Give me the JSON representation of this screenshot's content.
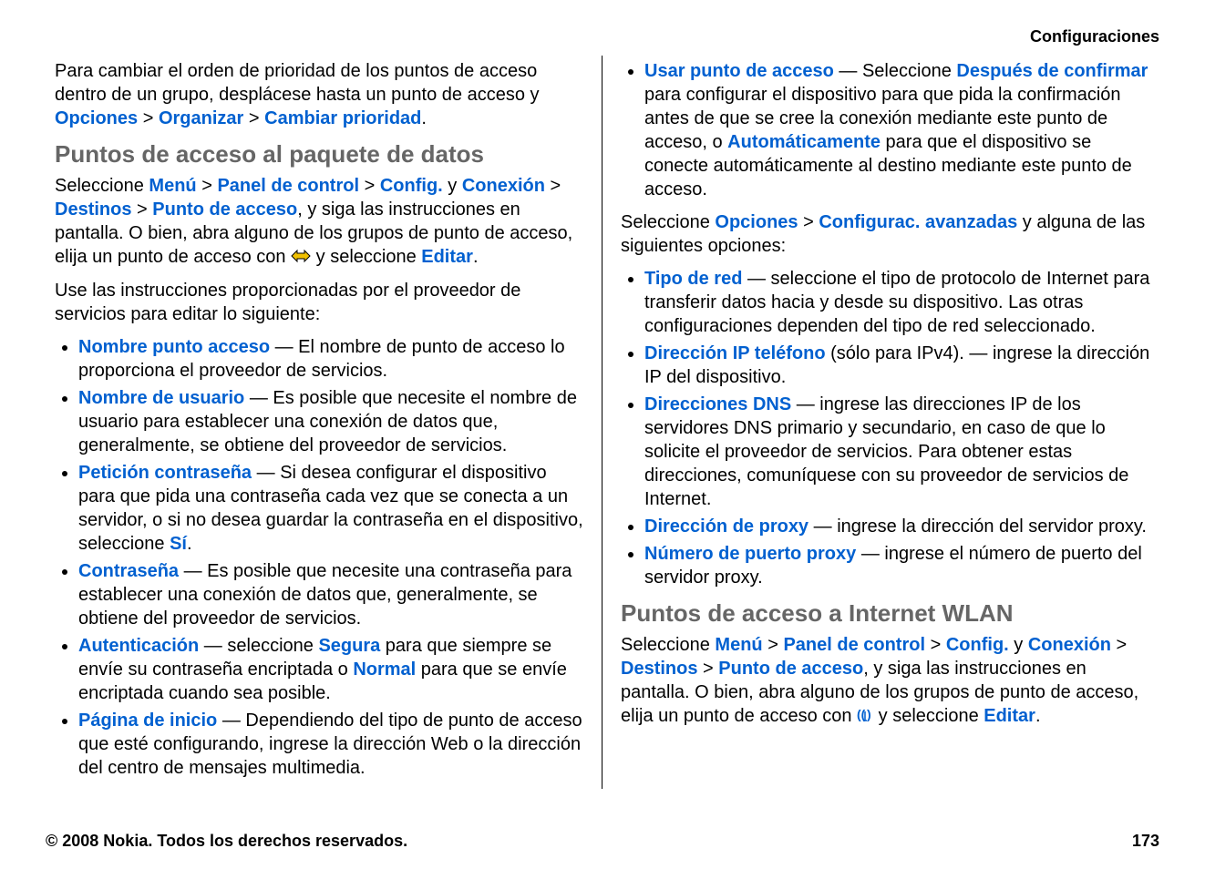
{
  "header": "Configuraciones",
  "left": {
    "intro_p1_a": "Para cambiar el orden de prioridad de los puntos de acceso dentro de un grupo, desplácese hasta un punto de acceso y ",
    "intro_opciones": "Opciones",
    "gt": ">",
    "intro_organizar": "Organizar",
    "intro_cambiar": "Cambiar prioridad",
    "period": ".",
    "h_datos": "Puntos de acceso al paquete de datos",
    "sel_a": "Seleccione ",
    "menu": "Menú",
    "panel": "Panel de control",
    "config": "Config.",
    "y": " y ",
    "conexion": "Conexión",
    "destinos": "Destinos",
    "punto_acceso": "Punto de acceso",
    "sel_b": ", y siga las instrucciones en pantalla. O bien, abra alguno de los grupos de punto de acceso, elija un punto de acceso con ",
    "sel_c": " y seleccione ",
    "editar": "Editar",
    "use_p": "Use las instrucciones proporcionadas por el proveedor de servicios para editar lo siguiente:",
    "items": [
      {
        "term": "Nombre punto acceso",
        "dash": " — ",
        "text": "El nombre de punto de acceso lo proporciona el proveedor de servicios."
      },
      {
        "term": "Nombre de usuario",
        "dash": " — ",
        "text": "Es posible que necesite el nombre de usuario para establecer una conexión de datos que, generalmente, se obtiene del proveedor de servicios."
      },
      {
        "term": "Petición contraseña",
        "dash": " — ",
        "text_a": "Si desea configurar el dispositivo para que pida una contraseña cada vez que se conecta a un servidor, o si no desea guardar la contraseña en el dispositivo, seleccione ",
        "si": "Sí",
        "text_b": "."
      },
      {
        "term": "Contraseña",
        "dash": " — ",
        "text": "Es posible que necesite una contraseña para establecer una conexión de datos que, generalmente, se obtiene del proveedor de servicios."
      },
      {
        "term": "Autenticación",
        "dash": " — ",
        "text_a": " seleccione ",
        "segura": "Segura",
        "text_b": " para que siempre se envíe su contraseña encriptada o ",
        "normal": "Normal",
        "text_c": " para que se envíe encriptada cuando sea posible."
      },
      {
        "term": "Página de inicio",
        "dash": " — ",
        "text": "Dependiendo del tipo de punto de acceso que esté configurando, ingrese la dirección Web o la dirección del centro de mensajes multimedia."
      }
    ]
  },
  "right": {
    "item_usar": {
      "term": "Usar punto de acceso",
      "dash": " — ",
      "text_a": "Seleccione ",
      "despues": "Después de confirmar",
      "text_b": " para configurar el dispositivo para que pida la confirmación antes de que se cree la conexión mediante este punto de acceso, o ",
      "auto": "Automáticamente",
      "text_c": " para que el dispositivo se conecte automáticamente al destino mediante este punto de acceso."
    },
    "sel_a": "Seleccione ",
    "opciones": "Opciones",
    "gt": ">",
    "configurac": "Configurac. avanzadas",
    "sel_b": " y alguna de las siguientes opciones:",
    "items": [
      {
        "term": "Tipo de red",
        "dash": " — ",
        "text": " seleccione el tipo de protocolo de Internet para transferir datos hacia y desde su dispositivo. Las otras configuraciones dependen del tipo de red seleccionado."
      },
      {
        "term": "Dirección IP teléfono",
        "dash": "",
        "text": " (sólo para IPv4). —  ingrese la dirección IP del dispositivo."
      },
      {
        "term": "Direcciones DNS",
        "dash": " — ",
        "text": " ingrese las direcciones IP de los servidores DNS primario y secundario, en caso de que lo solicite el proveedor de servicios. Para obtener estas direcciones, comuníquese con su proveedor de servicios de Internet."
      },
      {
        "term": "Dirección de proxy",
        "dash": " — ",
        "text": " ingrese la dirección del servidor proxy."
      },
      {
        "term": "Número de puerto proxy",
        "dash": " — ",
        "text": " ingrese el número de puerto del servidor proxy."
      }
    ],
    "h_wlan": "Puntos de acceso a Internet WLAN",
    "wsel_a": "Seleccione ",
    "wsel_b": ", y siga las instrucciones en pantalla. O bien, abra alguno de los grupos de punto de acceso, elija un punto de acceso con ",
    "wsel_c": " y seleccione ",
    "editar": "Editar"
  },
  "footer": {
    "copyright": "© 2008 Nokia. Todos los derechos reservados.",
    "page": "173"
  }
}
